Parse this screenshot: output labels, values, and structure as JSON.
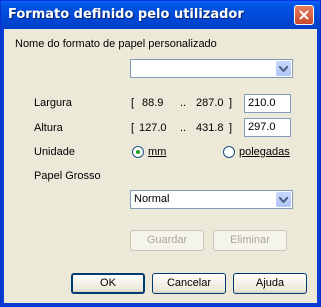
{
  "window": {
    "title": "Formato definido pelo utilizador"
  },
  "paper_format": {
    "label": "Nome do formato de papel personalizado",
    "value": ""
  },
  "width": {
    "label": "Largura",
    "range_open": "[",
    "range_min": "88.9",
    "range_sep": "..",
    "range_max": "287.0",
    "range_close": "]",
    "value": "210.0"
  },
  "height": {
    "label": "Altura",
    "range_open": "[",
    "range_min": "127.0",
    "range_sep": "..",
    "range_max": "431.8",
    "range_close": "]",
    "value": "297.0"
  },
  "unit": {
    "label": "Unidade",
    "option_mm": "mm",
    "option_inches": "polegadas",
    "selected": "mm"
  },
  "thick_paper": {
    "label": "Papel Grosso",
    "value": "Normal"
  },
  "buttons": {
    "save": "Guardar",
    "delete": "Eliminar",
    "ok": "OK",
    "cancel": "Cancelar",
    "help": "Ajuda"
  }
}
